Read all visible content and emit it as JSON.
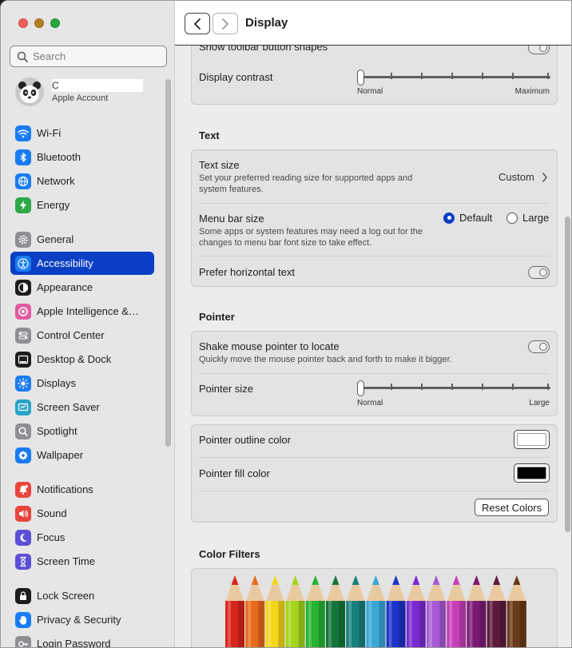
{
  "sidebar": {
    "search_placeholder": "Search",
    "account": {
      "initial": "C",
      "subtitle": "Apple Account"
    },
    "items": [
      {
        "label": "Wi-Fi",
        "icon": "wifi-icon",
        "color": "#1a7cf5"
      },
      {
        "label": "Bluetooth",
        "icon": "bluetooth-icon",
        "color": "#1a7cf5"
      },
      {
        "label": "Network",
        "icon": "globe-icon",
        "color": "#1a7cf5"
      },
      {
        "label": "Energy",
        "icon": "bolt-icon",
        "color": "#2fa84a"
      },
      {
        "label": "General",
        "icon": "gear-icon",
        "color": "#8e8e93"
      },
      {
        "label": "Accessibility",
        "icon": "accessibility-icon",
        "color": "#1a7cf5"
      },
      {
        "label": "Appearance",
        "icon": "appearance-icon",
        "color": "#1c1c1e"
      },
      {
        "label": "Apple Intelligence &…",
        "icon": "apple-intelligence-icon",
        "color": "#e35aa0"
      },
      {
        "label": "Control Center",
        "icon": "control-center-icon",
        "color": "#8e8e93"
      },
      {
        "label": "Desktop & Dock",
        "icon": "dock-icon",
        "color": "#1c1c1e"
      },
      {
        "label": "Displays",
        "icon": "sun-icon",
        "color": "#1a7cf5"
      },
      {
        "label": "Screen Saver",
        "icon": "screen-saver-icon",
        "color": "#2aa3c9"
      },
      {
        "label": "Spotlight",
        "icon": "magnifier-icon",
        "color": "#8e8e93"
      },
      {
        "label": "Wallpaper",
        "icon": "flower-icon",
        "color": "#1a7cf5"
      },
      {
        "label": "Notifications",
        "icon": "bell-icon",
        "color": "#e8453c"
      },
      {
        "label": "Sound",
        "icon": "speaker-icon",
        "color": "#e8453c"
      },
      {
        "label": "Focus",
        "icon": "moon-icon",
        "color": "#5b4fd6"
      },
      {
        "label": "Screen Time",
        "icon": "hourglass-icon",
        "color": "#5b4fd6"
      },
      {
        "label": "Lock Screen",
        "icon": "lock-icon",
        "color": "#1c1c1e"
      },
      {
        "label": "Privacy & Security",
        "icon": "hand-icon",
        "color": "#1a7cf5"
      },
      {
        "label": "Login Password",
        "icon": "key-icon",
        "color": "#8e8e93"
      }
    ]
  },
  "toolbar": {
    "title": "Display"
  },
  "display": {
    "toolbar_shapes_label": "Show toolbar button shapes",
    "contrast_label": "Display contrast",
    "contrast_min": "Normal",
    "contrast_max": "Maximum"
  },
  "text_section": {
    "title": "Text",
    "text_size_label": "Text size",
    "text_size_desc": "Set your preferred reading size for supported apps and system features.",
    "text_size_value": "Custom",
    "menu_bar_label": "Menu bar size",
    "menu_bar_desc": "Some apps or system features may need a log out for the changes to menu bar font size to take effect.",
    "menu_bar_options": [
      "Default",
      "Large"
    ],
    "horizontal_label": "Prefer horizontal text"
  },
  "pointer_section": {
    "title": "Pointer",
    "shake_label": "Shake mouse pointer to locate",
    "shake_desc": "Quickly move the mouse pointer back and forth to make it bigger.",
    "size_label": "Pointer size",
    "size_min": "Normal",
    "size_max": "Large",
    "outline_label": "Pointer outline color",
    "outline_color": "#ffffff",
    "fill_label": "Pointer fill color",
    "fill_color": "#000000",
    "reset_label": "Reset Colors"
  },
  "filters_section": {
    "title": "Color Filters",
    "pencil_colors": [
      "#d8261d",
      "#ea6a1d",
      "#f3d61a",
      "#a3d51c",
      "#26b431",
      "#13753a",
      "#17807c",
      "#39a6d6",
      "#1c33c7",
      "#7a2ad1",
      "#a95ad6",
      "#c63fb8",
      "#7b1a74",
      "#5c1a3c",
      "#6b3a18"
    ]
  }
}
